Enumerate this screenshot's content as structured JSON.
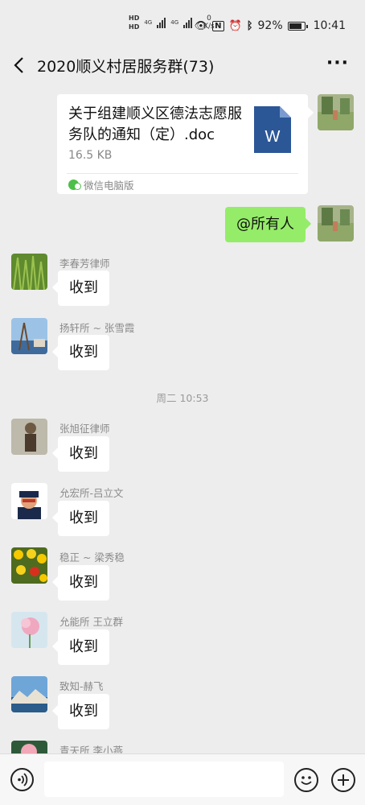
{
  "status_bar": {
    "hd_top": "HD",
    "hd_bottom": "HD",
    "net1": "4G",
    "net2": "4G",
    "speed_value": "0",
    "speed_unit": "K/s",
    "battery_text": "92%",
    "battery_level": 0.92,
    "time": "10:41",
    "icons": [
      "eye-icon",
      "nfc-icon",
      "alarm-icon",
      "bluetooth-icon",
      "battery-icon"
    ]
  },
  "header": {
    "title": "2020顺义村居服务群(73)",
    "back_icon": "chevron-left-icon",
    "more_icon": "more-horizontal-icon"
  },
  "file_message": {
    "filename": "关于组建顺义区德法志愿服务队的通知（定）.doc",
    "size": "16.5 KB",
    "source": "微信电脑版",
    "file_icon_letter": "W",
    "file_icon_color": "#2b5797"
  },
  "self_message": {
    "text": "@所有人"
  },
  "messages_before": [
    {
      "sender": "李春芳律师",
      "text": "收到"
    },
    {
      "sender": "扬轩所 ~ 张雪霞",
      "text": "收到"
    }
  ],
  "time_separator": "周二 10:53",
  "messages_after": [
    {
      "sender": "张旭征律师",
      "text": "收到"
    },
    {
      "sender": "允宏所-吕立文",
      "text": "收到"
    },
    {
      "sender": "稳正 ~ 梁秀稳",
      "text": "收到"
    },
    {
      "sender": "允能所 王立群",
      "text": "收到"
    },
    {
      "sender": "致知-赫飞",
      "text": "收到"
    },
    {
      "sender": "青天所 李小燕",
      "text": ""
    }
  ],
  "input_bar": {
    "placeholder": "",
    "voice_icon": "voice-icon",
    "emoji_icon": "emoji-icon",
    "plus_icon": "plus-icon"
  },
  "colors": {
    "background": "#ededed",
    "self_bubble": "#95ec69",
    "other_bubble": "#ffffff"
  }
}
